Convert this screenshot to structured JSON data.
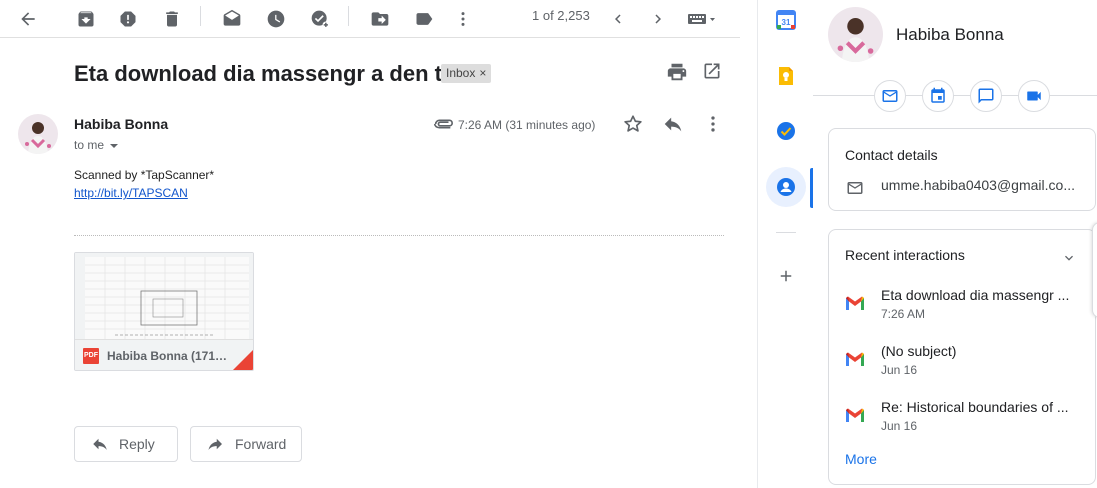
{
  "toolbar": {
    "icons": [
      "back-arrow-icon",
      "archive-icon",
      "report-spam-icon",
      "delete-icon",
      "mark-unread-icon",
      "snooze-icon",
      "add-to-tasks-icon",
      "move-to-icon",
      "label-icon",
      "more-vert-icon",
      "chevron-left-icon",
      "chevron-right-icon",
      "keyboard-icon"
    ],
    "pager": "1 of 2,253"
  },
  "email": {
    "subject": "Eta download dia massengr a den to",
    "label": "Inbox",
    "label_remove": "×",
    "sender": "Habiba Bonna",
    "recipient": "to me",
    "time": "7:26 AM (31 minutes ago)",
    "body_line1": "Scanned by *TapScanner*",
    "link": "http://bit.ly/TAPSCAN",
    "attachment": {
      "type_label": "PDF",
      "name": "Habiba Bonna (171…"
    }
  },
  "actions": {
    "reply": "Reply",
    "forward": "Forward"
  },
  "rail": {
    "apps": [
      "calendar-app-icon",
      "keep-app-icon",
      "tasks-app-icon",
      "contacts-app-icon",
      "add-app-icon"
    ],
    "calendar_day": "31"
  },
  "contact": {
    "name": "Habiba Bonna",
    "details_title": "Contact details",
    "email": "umme.habiba0403@gmail.co...",
    "recent_title": "Recent interactions",
    "interactions": [
      {
        "subject": "Eta download dia massengr ...",
        "date": "7:26 AM"
      },
      {
        "subject": "(No subject)",
        "date": "Jun 16"
      },
      {
        "subject": "Re: Historical boundaries of ...",
        "date": "Jun 16"
      }
    ],
    "more": "More"
  },
  "colors": {
    "accent": "#1a73e8",
    "gmail_red": "#ea4335",
    "link": "#1155cc"
  }
}
